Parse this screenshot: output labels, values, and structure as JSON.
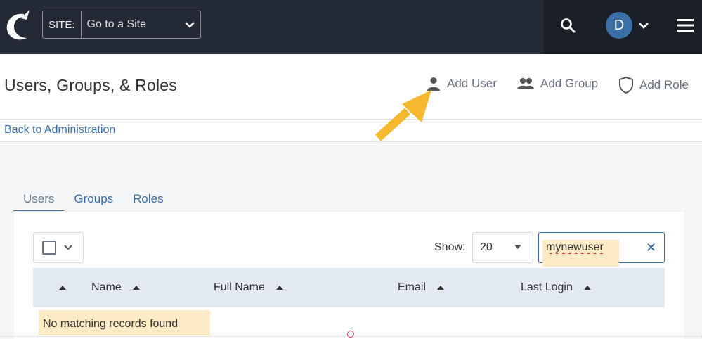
{
  "topbar": {
    "site_label": "SITE:",
    "site_value": "Go to a Site",
    "avatar_letter": "D"
  },
  "header": {
    "title": "Users, Groups, & Roles",
    "actions": {
      "add_user": "Add User",
      "add_group": "Add Group",
      "add_role": "Add Role"
    },
    "back_link": "Back to Administration"
  },
  "tabs": [
    {
      "label": "Users",
      "active": true
    },
    {
      "label": "Groups",
      "active": false
    },
    {
      "label": "Roles",
      "active": false
    }
  ],
  "toolbar": {
    "show_label": "Show:",
    "show_value": "20",
    "search_value": "mynewuser"
  },
  "table": {
    "columns": [
      "Name",
      "Full Name",
      "Email",
      "Last Login"
    ],
    "empty_message": "No matching records found"
  },
  "colors": {
    "topbar": "#242a35",
    "accent": "#3a6ea8",
    "highlight": "#fcebc4",
    "arrow": "#f5b82e"
  }
}
